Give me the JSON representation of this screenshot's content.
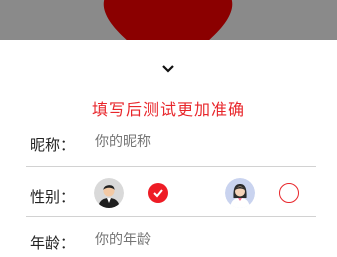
{
  "backdrop": {
    "color": "#8a8a8a",
    "heart_color": "#8b0000",
    "heart_icon": "heart-icon"
  },
  "sheet": {
    "collapse_icon": "chevron-down-icon",
    "headline": "填写后测试更加准确",
    "accent_color": "#e8262b",
    "nickname": {
      "label": "昵称：",
      "placeholder": "你的昵称",
      "value": ""
    },
    "gender": {
      "label": "性别：",
      "options": [
        {
          "avatar_icon": "male-avatar-icon",
          "selected": true
        },
        {
          "avatar_icon": "female-avatar-icon",
          "selected": false
        }
      ]
    },
    "age": {
      "label": "年龄：",
      "placeholder": "你的年龄",
      "value": ""
    }
  }
}
